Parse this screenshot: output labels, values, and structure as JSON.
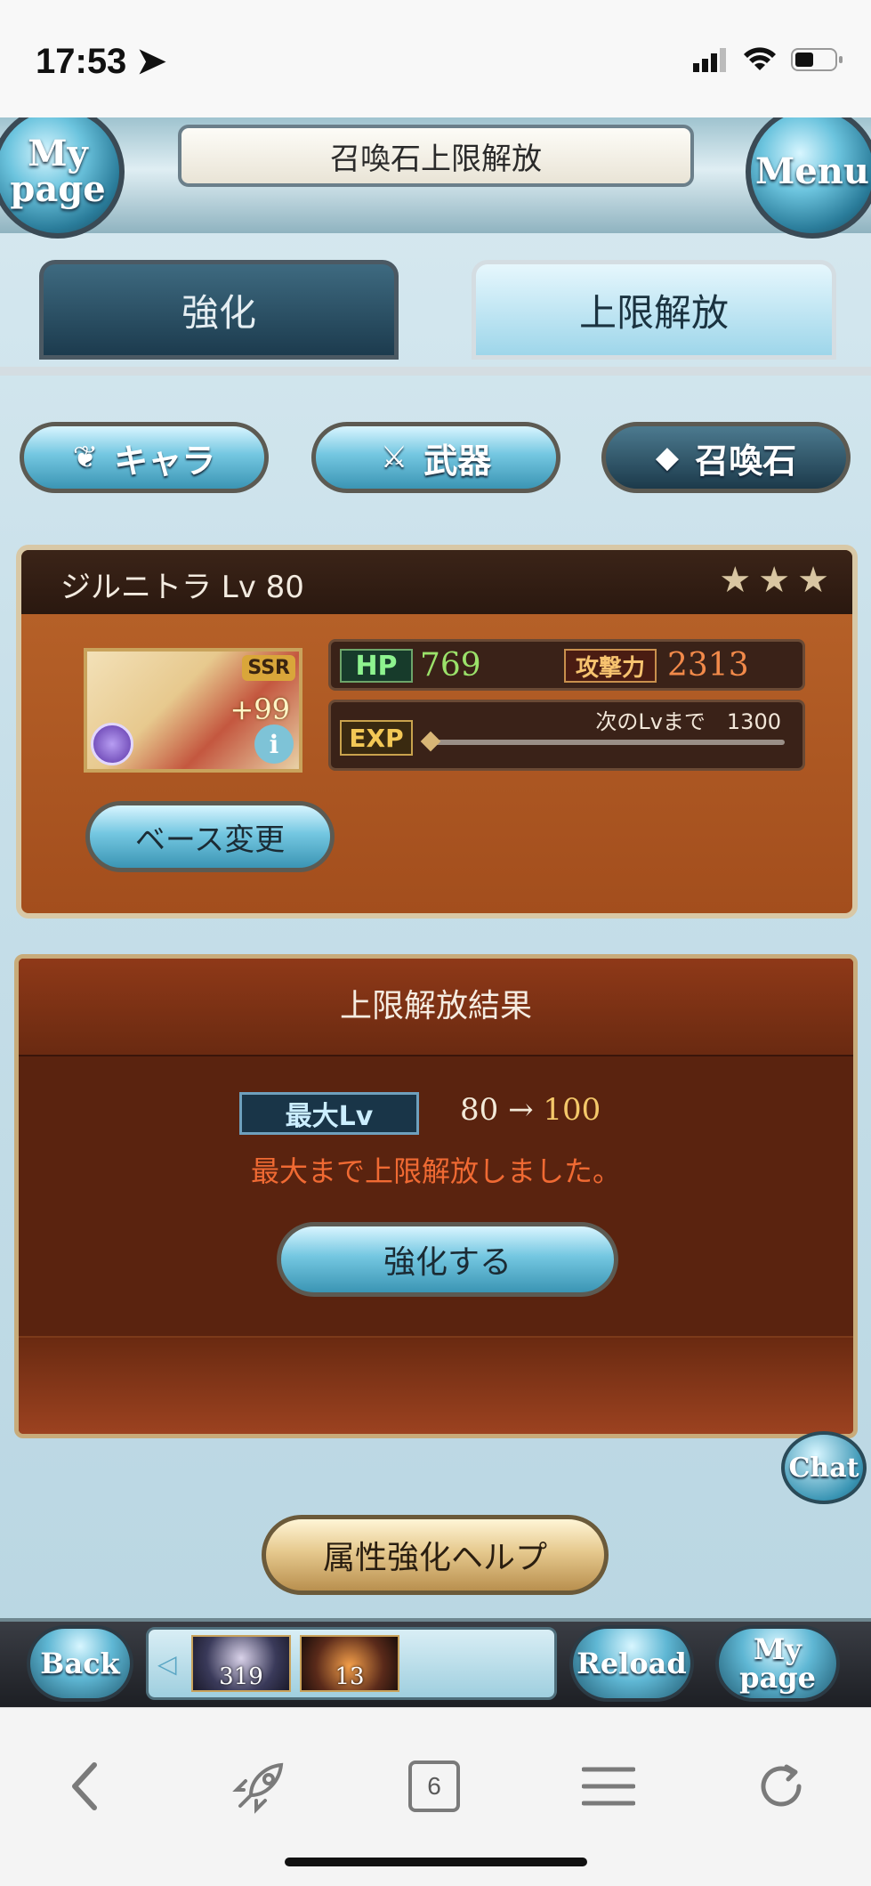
{
  "status_bar": {
    "time": "17:53"
  },
  "header": {
    "title": "召喚石上限解放",
    "mypage_label": "My page",
    "menu_label": "Menu"
  },
  "tabs": [
    {
      "label": "強化",
      "active": false
    },
    {
      "label": "上限解放",
      "active": true
    }
  ],
  "categories": [
    {
      "label": "キャラ",
      "icon": "chara-icon",
      "selected": false
    },
    {
      "label": "武器",
      "icon": "weapon-icon",
      "selected": false
    },
    {
      "label": "召喚石",
      "icon": "crystal-icon",
      "selected": true
    }
  ],
  "summon": {
    "name_level": "ジルニトラ Lv 80",
    "rarity_badge": "SSR",
    "plus": "+99",
    "hp_label": "HP",
    "hp": "769",
    "atk_label": "攻撃力",
    "atk": "2313",
    "exp_label": "EXP",
    "exp_next": "次のLvまで　1300",
    "stars": 3,
    "base_change_label": "ベース変更"
  },
  "result": {
    "title": "上限解放結果",
    "maxlv_label": "最大Lv",
    "maxlv_from_arrow": "80 →",
    "maxlv_to": "100",
    "message": "最大まで上限解放しました。",
    "enhance_label": "強化する"
  },
  "chat_label": "Chat",
  "help_label": "属性強化ヘルプ",
  "game_nav": {
    "back_label": "Back",
    "reload_label": "Reload",
    "mypage_label": "My page",
    "quest_counts": [
      "319",
      "13"
    ]
  },
  "browser": {
    "tabs_count": "6"
  },
  "colors": {
    "accent_blue": "#74c7e1",
    "panel_brown": "#a34e1d",
    "result_red": "#f06a33",
    "hp_green": "#9be26a"
  }
}
